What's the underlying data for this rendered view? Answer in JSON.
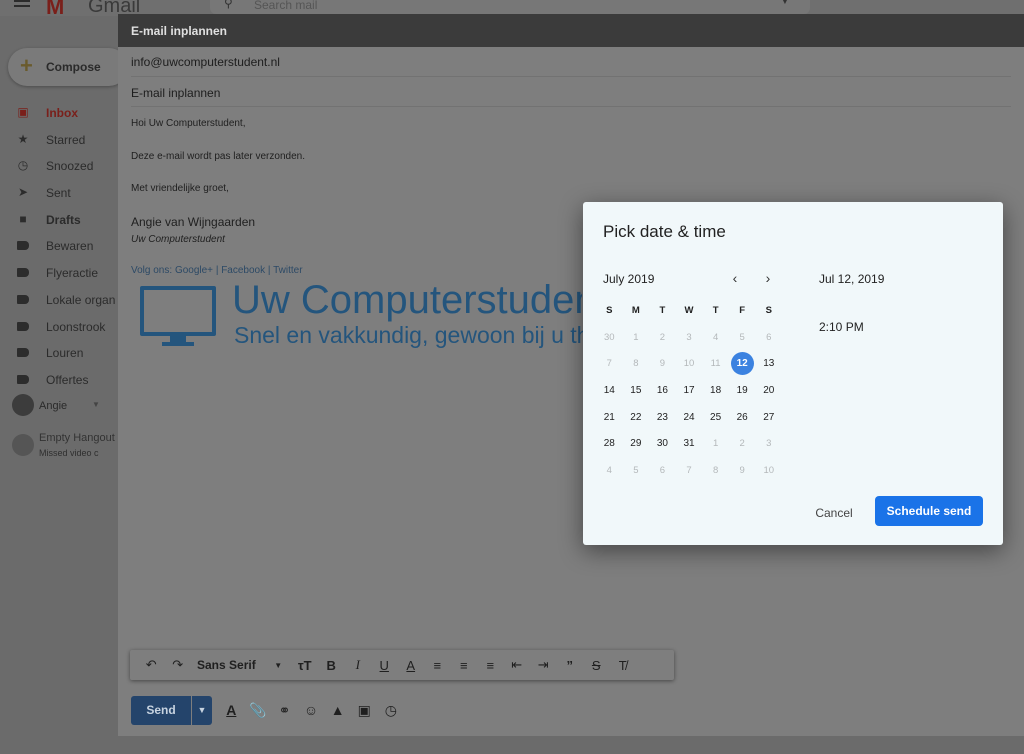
{
  "gmail": {
    "logo_text": "Gmail",
    "search_placeholder": "Search mail",
    "compose_label": "Compose",
    "nav": [
      {
        "label": "Inbox",
        "icon": "inbox-icon"
      },
      {
        "label": "Starred",
        "icon": "star-icon"
      },
      {
        "label": "Snoozed",
        "icon": "clock-icon"
      },
      {
        "label": "Sent",
        "icon": "send-icon"
      },
      {
        "label": "Drafts",
        "icon": "draft-icon"
      },
      {
        "label": "Bewaren",
        "icon": "label-icon"
      },
      {
        "label": "Flyeractie",
        "icon": "label-icon"
      },
      {
        "label": "Lokale organ",
        "icon": "label-icon"
      },
      {
        "label": "Loonstrook",
        "icon": "label-icon"
      },
      {
        "label": "Louren",
        "icon": "label-icon"
      },
      {
        "label": "Offertes",
        "icon": "label-icon"
      }
    ],
    "hangouts": {
      "user": "Angie",
      "empty_title": "Empty Hangout",
      "empty_sub": "Missed video c"
    }
  },
  "compose": {
    "title": "E-mail inplannen",
    "to": "info@uwcomputerstudent.nl",
    "subject": "E-mail inplannen",
    "body": {
      "greeting": "Hoi Uw Computerstudent,",
      "line1": "Deze e-mail wordt pas later verzonden.",
      "closing": "Met vriendelijke groet,",
      "sig_name": "Angie van Wijngaarden",
      "sig_org": "Uw Computerstudent",
      "social_prefix": "Volg ons:",
      "social_links": [
        "Google+",
        "Facebook",
        "Twitter"
      ],
      "brand_name": "Uw Computerstudent",
      "brand_tagline": "Snel en vakkundig, gewoon bij u thuis"
    },
    "toolbar": {
      "font": "Sans Serif"
    },
    "send_label": "Send"
  },
  "schedule_dialog": {
    "title": "Pick date & time",
    "month_label": "July 2019",
    "weekdays": [
      "S",
      "M",
      "T",
      "W",
      "T",
      "F",
      "S"
    ],
    "weeks": [
      [
        "30",
        "1",
        "2",
        "3",
        "4",
        "5",
        "6"
      ],
      [
        "7",
        "8",
        "9",
        "10",
        "11",
        "12",
        "13"
      ],
      [
        "14",
        "15",
        "16",
        "17",
        "18",
        "19",
        "20"
      ],
      [
        "21",
        "22",
        "23",
        "24",
        "25",
        "26",
        "27"
      ],
      [
        "28",
        "29",
        "30",
        "31",
        "1",
        "2",
        "3"
      ],
      [
        "4",
        "5",
        "6",
        "7",
        "8",
        "9",
        "10"
      ]
    ],
    "selected_date": "Jul 12, 2019",
    "selected_time": "2:10 PM",
    "cancel_label": "Cancel",
    "schedule_label": "Schedule send",
    "colors": {
      "accent": "#1a73e8",
      "selected_day": "#3b82e0"
    }
  }
}
